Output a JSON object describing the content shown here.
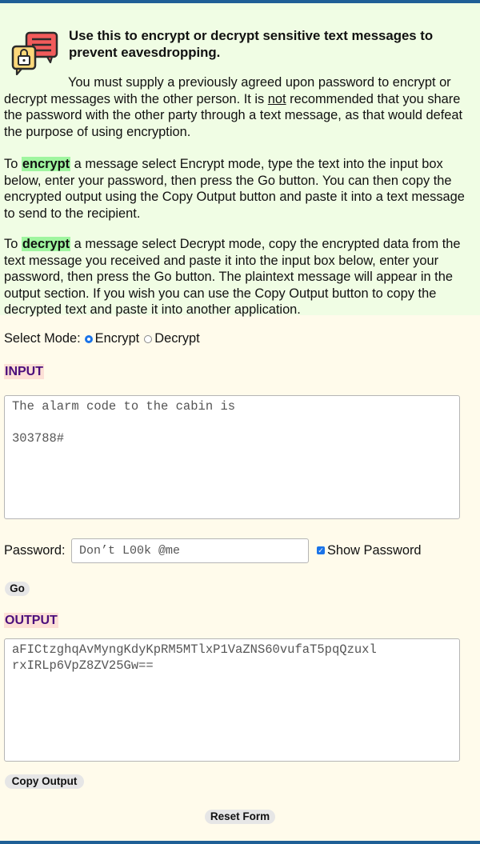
{
  "intro": {
    "heading": "Use this to encrypt or decrypt sensitive text messages to prevent eavesdropping.",
    "p1_a": "You must supply a previously agreed upon password to encrypt or decrypt messages with the other person. It is ",
    "p1_not": "not",
    "p1_b": " recommended that you share the password with the other party through a text message, as that would defeat the purpose of using encryption.",
    "p2_a": "To ",
    "p2_hl": "encrypt",
    "p2_b": " a message select Encrypt mode, type the text into the input box below, enter your password, then press the Go button. You can then copy the encrypted output using the Copy Output button and paste it into a text message to send to the recipient.",
    "p3_a": "To ",
    "p3_hl": "decrypt",
    "p3_b": " a message select Decrypt mode, copy the encrypted data from the text message you received and paste it into the input box below, enter your password, then press the Go button. The plaintext message will appear in the output section. If you wish you can use the Copy Output button to copy the decrypted text and paste it into another application."
  },
  "mode": {
    "label": "Select Mode:",
    "options": [
      "Encrypt",
      "Decrypt"
    ],
    "selected": "Encrypt"
  },
  "input": {
    "label": "INPUT",
    "value": "The alarm code to the cabin is\n\n303788#"
  },
  "password": {
    "label": "Password:",
    "value": "Don’t L00k @me",
    "show_label": "Show Password",
    "show_checked": true
  },
  "buttons": {
    "go": "Go",
    "copy": "Copy Output",
    "reset": "Reset Form"
  },
  "output": {
    "label": "OUTPUT",
    "value": "aFICtzghqAvMyngKdyKpRM5MTlxP1VaZNS60vufaT5pqQzuxl\nrxIRLp6VpZ8ZV25Gw=="
  },
  "colors": {
    "accent_bar": "#1f5f96",
    "intro_bg": "#f0fde4",
    "page_bg": "#fffbeb",
    "highlight": "#9ff59f",
    "section_label": "#4b0e7c"
  },
  "icons": [
    "secure-chat-icon"
  ]
}
